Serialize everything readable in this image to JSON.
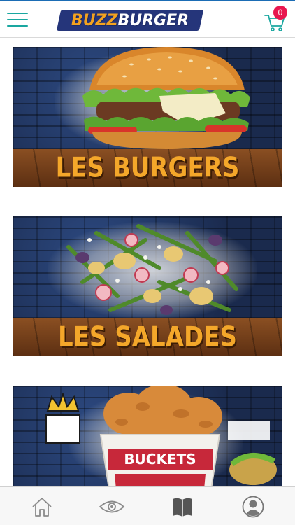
{
  "app": {
    "name": "BuzzBurger"
  },
  "header": {
    "logo_part1": "BUZZ",
    "logo_part2": "BURGER",
    "cart_count": "0",
    "menu_icon": "hamburger-menu-icon",
    "cart_icon": "shopping-cart-icon"
  },
  "categories": [
    {
      "label": "LES BURGERS"
    },
    {
      "label": "LES SALADES"
    },
    {
      "label": "BUCKETS"
    }
  ],
  "tabbar": {
    "items": [
      {
        "icon": "home-icon"
      },
      {
        "icon": "eye-icon"
      },
      {
        "icon": "book-icon"
      },
      {
        "icon": "profile-icon"
      }
    ]
  },
  "colors": {
    "accent": "#1aa7a0",
    "badge": "#e8174f",
    "logo_orange": "#f3a21f",
    "logo_navy": "#25357a",
    "title_orange": "#f4a72a",
    "tab_icon": "#8a8a8a",
    "tab_icon_active": "#555555"
  }
}
